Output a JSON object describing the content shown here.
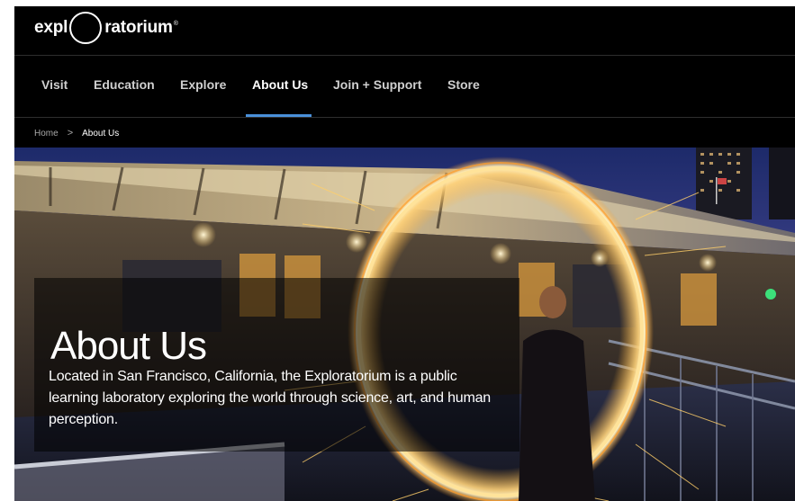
{
  "brand": {
    "logo_left": "expl",
    "logo_right": "ratorium",
    "logo_reg": "®"
  },
  "nav": {
    "items": [
      {
        "label": "Visit",
        "active": false
      },
      {
        "label": "Education",
        "active": false
      },
      {
        "label": "Explore",
        "active": false
      },
      {
        "label": "About Us",
        "active": true
      },
      {
        "label": "Join + Support",
        "active": false
      },
      {
        "label": "Store",
        "active": false
      }
    ]
  },
  "breadcrumb": {
    "home": "Home",
    "separator": ">",
    "current": "About Us"
  },
  "hero": {
    "title": "About Us",
    "body": "Located in San Francisco, California, the Exploratorium is a public learning laboratory exploring the world through science, art, and human perception."
  },
  "colors": {
    "nav_active_underline": "#4a90d9",
    "background": "#000000",
    "ring_glow": "#ffb23a"
  }
}
